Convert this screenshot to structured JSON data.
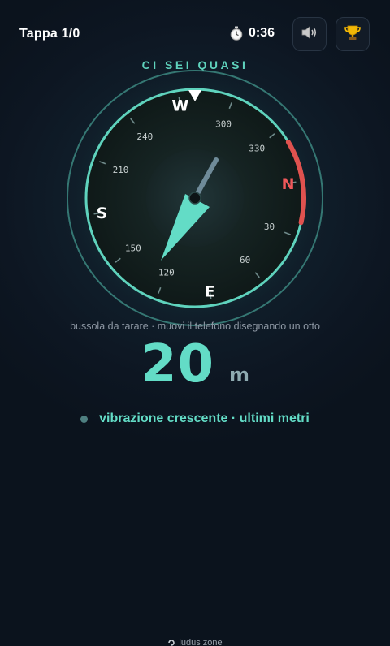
{
  "header": {
    "stage_label": "Tappa 1/0",
    "timer": "0:36"
  },
  "status_label": "CI SEI QUASI",
  "compass": {
    "cardinals": [
      {
        "label": "N",
        "color": "#f0585a"
      },
      {
        "label": "E",
        "color": "#ffffff"
      },
      {
        "label": "S",
        "color": "#ffffff"
      },
      {
        "label": "W",
        "color": "#ffffff"
      }
    ],
    "degree_labels": [
      "30",
      "60",
      "120",
      "150",
      "210",
      "240",
      "300",
      "330"
    ],
    "arc_color": "#e0524f",
    "needle_color": "#63dcc6",
    "ring_color": "#5fd3bd"
  },
  "hint": "bussola da tarare · muovi il telefono disegnando un otto",
  "distance": {
    "value": "20",
    "unit": "m"
  },
  "feedback": "vibrazione crescente · ultimi metri",
  "footer": {
    "brand": "ludus zone"
  },
  "icons": {
    "timer": "stopwatch-icon",
    "sound": "speaker-icon",
    "trophy": "trophy-icon"
  }
}
